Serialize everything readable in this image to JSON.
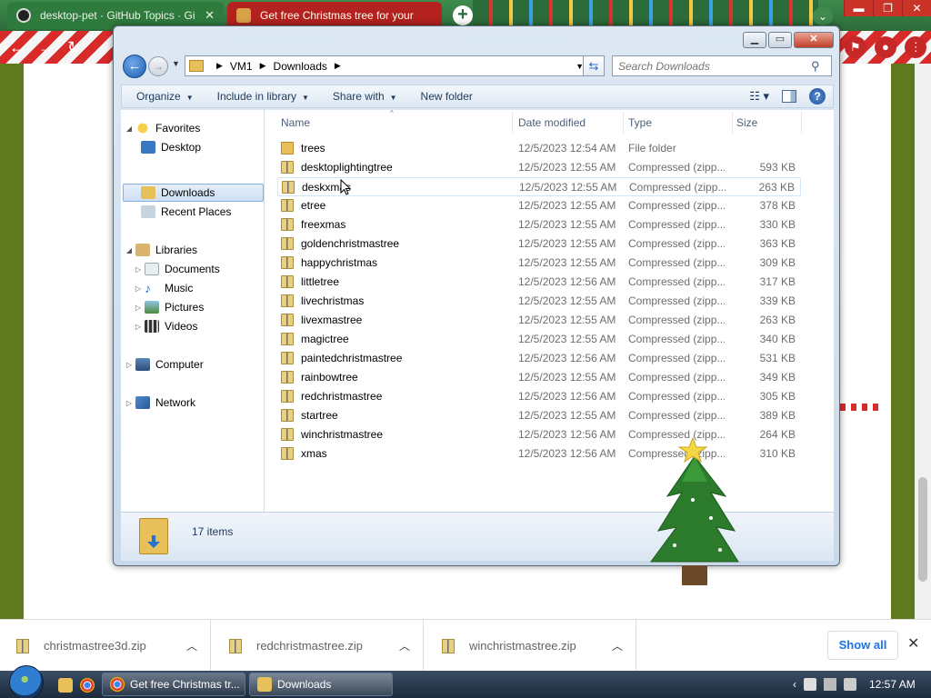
{
  "browser": {
    "tabs": [
      {
        "title": "desktop-pet · GitHub Topics · Gi"
      },
      {
        "title": "Get free Christmas tree for your"
      }
    ],
    "window_buttons": [
      "▬",
      "❐",
      "✕"
    ]
  },
  "explorer": {
    "address": {
      "segments": [
        "VM1",
        "Downloads"
      ]
    },
    "search": {
      "placeholder": "Search Downloads"
    },
    "commands": [
      {
        "label": "Organize"
      },
      {
        "label": "Include in library"
      },
      {
        "label": "Share with"
      },
      {
        "label": "New folder"
      }
    ],
    "nav": {
      "favorites": "Favorites",
      "desktop": "Desktop",
      "downloads": "Downloads",
      "recent_places": "Recent Places",
      "libraries": "Libraries",
      "documents": "Documents",
      "music": "Music",
      "pictures": "Pictures",
      "videos": "Videos",
      "computer": "Computer",
      "network": "Network"
    },
    "columns": {
      "name": "Name",
      "date": "Date modified",
      "type": "Type",
      "size": "Size"
    },
    "files": [
      {
        "name": "trees",
        "date": "12/5/2023 12:54 AM",
        "type": "File folder",
        "size": "",
        "kind": "folder"
      },
      {
        "name": "desktoplightingtree",
        "date": "12/5/2023 12:55 AM",
        "type": "Compressed (zipp...",
        "size": "593 KB",
        "kind": "zip"
      },
      {
        "name": "deskxmas",
        "date": "12/5/2023 12:55 AM",
        "type": "Compressed (zipp...",
        "size": "263 KB",
        "kind": "zip"
      },
      {
        "name": "etree",
        "date": "12/5/2023 12:55 AM",
        "type": "Compressed (zipp...",
        "size": "378 KB",
        "kind": "zip"
      },
      {
        "name": "freexmas",
        "date": "12/5/2023 12:55 AM",
        "type": "Compressed (zipp...",
        "size": "330 KB",
        "kind": "zip"
      },
      {
        "name": "goldenchristmastree",
        "date": "12/5/2023 12:55 AM",
        "type": "Compressed (zipp...",
        "size": "363 KB",
        "kind": "zip"
      },
      {
        "name": "happychristmas",
        "date": "12/5/2023 12:55 AM",
        "type": "Compressed (zipp...",
        "size": "309 KB",
        "kind": "zip"
      },
      {
        "name": "littletree",
        "date": "12/5/2023 12:56 AM",
        "type": "Compressed (zipp...",
        "size": "317 KB",
        "kind": "zip"
      },
      {
        "name": "livechristmas",
        "date": "12/5/2023 12:55 AM",
        "type": "Compressed (zipp...",
        "size": "339 KB",
        "kind": "zip"
      },
      {
        "name": "livexmastree",
        "date": "12/5/2023 12:55 AM",
        "type": "Compressed (zipp...",
        "size": "263 KB",
        "kind": "zip"
      },
      {
        "name": "magictree",
        "date": "12/5/2023 12:55 AM",
        "type": "Compressed (zipp...",
        "size": "340 KB",
        "kind": "zip"
      },
      {
        "name": "paintedchristmastree",
        "date": "12/5/2023 12:56 AM",
        "type": "Compressed (zipp...",
        "size": "531 KB",
        "kind": "zip"
      },
      {
        "name": "rainbowtree",
        "date": "12/5/2023 12:55 AM",
        "type": "Compressed (zipp...",
        "size": "349 KB",
        "kind": "zip"
      },
      {
        "name": "redchristmastree",
        "date": "12/5/2023 12:56 AM",
        "type": "Compressed (zipp...",
        "size": "305 KB",
        "kind": "zip"
      },
      {
        "name": "startree",
        "date": "12/5/2023 12:55 AM",
        "type": "Compressed (zipp...",
        "size": "389 KB",
        "kind": "zip"
      },
      {
        "name": "winchristmastree",
        "date": "12/5/2023 12:56 AM",
        "type": "Compressed (zipp...",
        "size": "264 KB",
        "kind": "zip"
      },
      {
        "name": "xmas",
        "date": "12/5/2023 12:56 AM",
        "type": "Compressed (zipp...",
        "size": "310 KB",
        "kind": "zip"
      }
    ],
    "status": {
      "count": "17 items"
    }
  },
  "downloads": {
    "items": [
      {
        "name": "christmastree3d.zip"
      },
      {
        "name": "redchristmastree.zip"
      },
      {
        "name": "winchristmastree.zip"
      }
    ],
    "show_all": "Show all"
  },
  "taskbar": {
    "tasks": [
      {
        "title": "Get free Christmas tr..."
      },
      {
        "title": "Downloads"
      }
    ],
    "clock": "12:57 AM"
  },
  "colors": {
    "accent": "#1a73e8",
    "chrome_green": "#2c6b3a",
    "candy_red": "#d92a2a",
    "page_green": "#5e7a1c"
  }
}
